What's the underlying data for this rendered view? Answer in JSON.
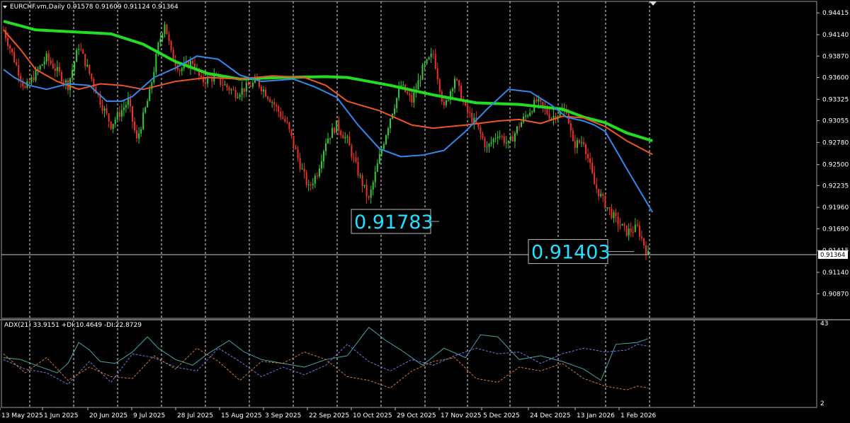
{
  "chart_data": {
    "type": "candlestick",
    "symbol_header": "EURCHF.vm,Daily  0.91578 0.91609 0.91124 0.91364",
    "price_axis": {
      "ylim": [
        0.9056,
        0.9456
      ],
      "ticks": [
        "0.94415",
        "0.94140",
        "0.93870",
        "0.93600",
        "0.93325",
        "0.93055",
        "0.92780",
        "0.92500",
        "0.92235",
        "0.91960",
        "0.91690",
        "0.91415",
        "0.91140",
        "0.90870"
      ],
      "current_price": "0.91364"
    },
    "date_axis": {
      "labels": [
        "13 May 2025",
        "1 Jun 2025",
        "20 Jun 2025",
        "9 Jul 2025",
        "28 Jul 2025",
        "15 Aug 2025",
        "3 Sep 2025",
        "22 Sep 2025",
        "10 Oct 2025",
        "29 Oct 2025",
        "17 Nov 2025",
        "5 Dec 2025",
        "24 Dec 2025",
        "13 Jan 2026",
        "1 Feb 2026"
      ]
    },
    "annotations": [
      {
        "text": "0.91783",
        "price": 0.91783
      },
      {
        "text": "0.91403",
        "price": 0.91403
      }
    ],
    "moving_averages": [
      {
        "color": "#22dd22",
        "points": [
          [
            0,
            0.9431
          ],
          [
            15,
            0.942
          ],
          [
            30,
            0.9418
          ],
          [
            50,
            0.9415
          ],
          [
            65,
            0.9402
          ],
          [
            80,
            0.938
          ],
          [
            95,
            0.9365
          ],
          [
            110,
            0.9358
          ],
          [
            130,
            0.936
          ],
          [
            150,
            0.9361
          ],
          [
            160,
            0.936
          ],
          [
            180,
            0.935
          ],
          [
            200,
            0.9338
          ],
          [
            220,
            0.9328
          ],
          [
            240,
            0.9326
          ],
          [
            260,
            0.932
          ],
          [
            270,
            0.931
          ],
          [
            280,
            0.9303
          ],
          [
            290,
            0.929
          ],
          [
            302,
            0.928
          ]
        ]
      },
      {
        "color": "#ee5522",
        "points": [
          [
            0,
            0.942
          ],
          [
            8,
            0.9395
          ],
          [
            15,
            0.937
          ],
          [
            25,
            0.9355
          ],
          [
            35,
            0.9345
          ],
          [
            45,
            0.9352
          ],
          [
            55,
            0.935
          ],
          [
            65,
            0.9345
          ],
          [
            80,
            0.9355
          ],
          [
            95,
            0.936
          ],
          [
            110,
            0.9358
          ],
          [
            125,
            0.9362
          ],
          [
            140,
            0.936
          ],
          [
            150,
            0.935
          ],
          [
            160,
            0.933
          ],
          [
            175,
            0.9318
          ],
          [
            190,
            0.93
          ],
          [
            200,
            0.9296
          ],
          [
            215,
            0.93
          ],
          [
            230,
            0.9305
          ],
          [
            240,
            0.9307
          ],
          [
            250,
            0.9302
          ],
          [
            260,
            0.9311
          ],
          [
            270,
            0.9309
          ],
          [
            280,
            0.9298
          ],
          [
            290,
            0.928
          ],
          [
            302,
            0.9263
          ]
        ]
      },
      {
        "color": "#3388ee",
        "points": [
          [
            0,
            0.937
          ],
          [
            5,
            0.936
          ],
          [
            12,
            0.935
          ],
          [
            20,
            0.9345
          ],
          [
            30,
            0.9352
          ],
          [
            40,
            0.935
          ],
          [
            48,
            0.933
          ],
          [
            55,
            0.933
          ],
          [
            60,
            0.9336
          ],
          [
            70,
            0.936
          ],
          [
            80,
            0.9372
          ],
          [
            90,
            0.9387
          ],
          [
            100,
            0.9383
          ],
          [
            110,
            0.9363
          ],
          [
            120,
            0.9355
          ],
          [
            135,
            0.9358
          ],
          [
            145,
            0.9348
          ],
          [
            155,
            0.9335
          ],
          [
            165,
            0.93
          ],
          [
            175,
            0.927
          ],
          [
            185,
            0.926
          ],
          [
            195,
            0.9262
          ],
          [
            205,
            0.9268
          ],
          [
            215,
            0.9292
          ],
          [
            225,
            0.932
          ],
          [
            235,
            0.9345
          ],
          [
            245,
            0.9342
          ],
          [
            255,
            0.9325
          ],
          [
            262,
            0.931
          ],
          [
            270,
            0.9305
          ],
          [
            275,
            0.93
          ],
          [
            280,
            0.9292
          ],
          [
            290,
            0.9245
          ],
          [
            302,
            0.919
          ]
        ]
      }
    ],
    "adx_panel": {
      "header": "ADX(21) 33.9151 +DI:10.4649 -DI:22.8729",
      "ylim": [
        2,
        43
      ],
      "ticks": [
        "43",
        "2"
      ],
      "series": [
        {
          "name": "ADX",
          "color": "#4aa3a3",
          "style": "solid",
          "points": [
            [
              0,
              26
            ],
            [
              8,
              25
            ],
            [
              15,
              22
            ],
            [
              25,
              18
            ],
            [
              30,
              23
            ],
            [
              35,
              34
            ],
            [
              40,
              30
            ],
            [
              45,
              24
            ],
            [
              52,
              23
            ],
            [
              60,
              29
            ],
            [
              67,
              37
            ],
            [
              72,
              31
            ],
            [
              80,
              25
            ],
            [
              88,
              22
            ],
            [
              95,
              28
            ],
            [
              105,
              35
            ],
            [
              112,
              29
            ],
            [
              120,
              25
            ],
            [
              130,
              23
            ],
            [
              140,
              21
            ],
            [
              150,
              25
            ],
            [
              160,
              27
            ],
            [
              170,
              42
            ],
            [
              178,
              35
            ],
            [
              185,
              30
            ],
            [
              195,
              22
            ],
            [
              205,
              31
            ],
            [
              215,
              26
            ],
            [
              222,
              38
            ],
            [
              230,
              37
            ],
            [
              240,
              25
            ],
            [
              250,
              27
            ],
            [
              260,
              24
            ],
            [
              270,
              20
            ],
            [
              278,
              14
            ],
            [
              285,
              33
            ],
            [
              295,
              34
            ],
            [
              300,
              36
            ]
          ]
        },
        {
          "name": "+DI",
          "color": "#7777ee",
          "style": "dashed",
          "points": [
            [
              0,
              25
            ],
            [
              10,
              20
            ],
            [
              20,
              18
            ],
            [
              30,
              12
            ],
            [
              40,
              24
            ],
            [
              50,
              13
            ],
            [
              60,
              28
            ],
            [
              70,
              26
            ],
            [
              80,
              21
            ],
            [
              90,
              19
            ],
            [
              100,
              31
            ],
            [
              110,
              24
            ],
            [
              120,
              16
            ],
            [
              130,
              21
            ],
            [
              140,
              17
            ],
            [
              150,
              22
            ],
            [
              160,
              33
            ],
            [
              170,
              24
            ],
            [
              180,
              19
            ],
            [
              190,
              25
            ],
            [
              200,
              22
            ],
            [
              210,
              27
            ],
            [
              220,
              31
            ],
            [
              230,
              28
            ],
            [
              240,
              29
            ],
            [
              250,
              23
            ],
            [
              260,
              28
            ],
            [
              270,
              31
            ],
            [
              280,
              29
            ],
            [
              290,
              30
            ],
            [
              295,
              33
            ],
            [
              300,
              32
            ]
          ]
        },
        {
          "name": "-DI",
          "color": "#d37a3a",
          "style": "dashed",
          "points": [
            [
              0,
              28
            ],
            [
              10,
              18
            ],
            [
              20,
              26
            ],
            [
              30,
              14
            ],
            [
              40,
              21
            ],
            [
              50,
              16
            ],
            [
              60,
              15
            ],
            [
              70,
              27
            ],
            [
              80,
              20
            ],
            [
              90,
              31
            ],
            [
              100,
              24
            ],
            [
              110,
              14
            ],
            [
              120,
              24
            ],
            [
              130,
              23
            ],
            [
              140,
              29
            ],
            [
              150,
              25
            ],
            [
              160,
              16
            ],
            [
              170,
              14
            ],
            [
              180,
              10
            ],
            [
              190,
              19
            ],
            [
              200,
              24
            ],
            [
              210,
              26
            ],
            [
              220,
              15
            ],
            [
              230,
              13
            ],
            [
              240,
              21
            ],
            [
              250,
              19
            ],
            [
              260,
              23
            ],
            [
              270,
              15
            ],
            [
              280,
              11
            ],
            [
              290,
              9
            ],
            [
              295,
              11
            ],
            [
              300,
              10
            ]
          ]
        }
      ]
    }
  }
}
